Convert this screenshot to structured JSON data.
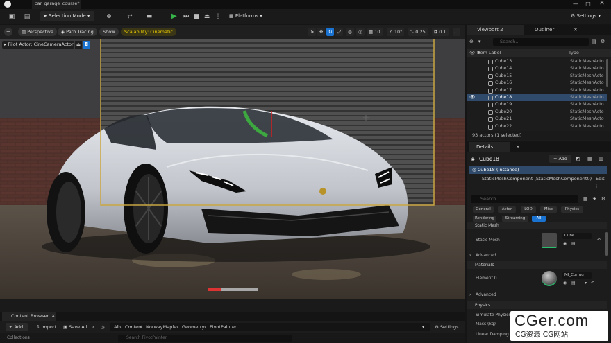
{
  "window": {
    "project_tab": "car_garage_course*",
    "minimize": "—",
    "maximize": "□",
    "close": "✕"
  },
  "toolbar": {
    "selection_mode": "Selection Mode",
    "platforms": "Platforms",
    "settings": "Settings"
  },
  "viewport_toolbar": {
    "perspective": "Perspective",
    "path_tracing": "Path Tracing",
    "show": "Show",
    "scalability": "Scalability: Cinematic",
    "grid_snap": "10",
    "rotation_snap": "10°",
    "scale_snap": "0.25",
    "camera_speed": "0.1"
  },
  "pilot": {
    "label": "Pilot Actor: CineCameraActor"
  },
  "right_tabs": {
    "viewport2": "Viewport 2",
    "outliner": "Outliner"
  },
  "outliner": {
    "search_placeholder": "Search...",
    "col_item_label": "Item Label",
    "col_type": "Type",
    "rows": [
      {
        "name": "Cube13",
        "type": "StaticMeshActo"
      },
      {
        "name": "Cube14",
        "type": "StaticMeshActo"
      },
      {
        "name": "Cube15",
        "type": "StaticMeshActo"
      },
      {
        "name": "Cube16",
        "type": "StaticMeshActo"
      },
      {
        "name": "Cube17",
        "type": "StaticMeshActo"
      },
      {
        "name": "Cube18",
        "type": "StaticMeshActo"
      },
      {
        "name": "Cube19",
        "type": "StaticMeshActo"
      },
      {
        "name": "Cube20",
        "type": "StaticMeshActo"
      },
      {
        "name": "Cube21",
        "type": "StaticMeshActo"
      },
      {
        "name": "Cube22",
        "type": "StaticMeshActo"
      }
    ],
    "selected_index": 5,
    "count": "93 actors (1 selected)"
  },
  "details": {
    "tab": "Details",
    "actor_name": "Cube18",
    "add_label": "+ Add",
    "instance": "Cube18 (Instance)",
    "component": "StaticMeshComponent (StaticMeshComponent0)",
    "component_edit": "Edit i",
    "search_placeholder": "Search",
    "filters": [
      "General",
      "Actor",
      "LOD",
      "Misc",
      "Physics",
      "Rendering",
      "Streaming",
      "All"
    ],
    "sec_static_mesh": "Static Mesh",
    "prop_static_mesh": "Static Mesh",
    "static_mesh_value": "Cube",
    "advanced1": "Advanced",
    "sec_materials": "Materials",
    "prop_element0": "Element 0",
    "material_value": "MI_Corrug",
    "advanced2": "Advanced",
    "sec_physics": "Physics",
    "prop_simulate": "Simulate Physics",
    "prop_mass": "Mass (kg)",
    "prop_linear_damping": "Linear Damping"
  },
  "content_browser": {
    "tab": "Content Browser",
    "add": "+ Add",
    "import": "Import",
    "save_all": "Save All",
    "path": [
      "All",
      "Content",
      "NorwayMaple",
      "Geometry",
      "PivotPainter"
    ],
    "settings": "Settings",
    "search_placeholder": "Search PivotPainter",
    "collections": "Collections"
  },
  "watermark": {
    "big": "CGer.com",
    "small": "CG资源 CG网站"
  },
  "colors": {
    "accent_blue": "#1a73d0",
    "selection_row": "#2f4a6a",
    "scalability_yellow": "#f0d000",
    "play_green": "#36b44a",
    "camera_frame": "#c9a640"
  }
}
